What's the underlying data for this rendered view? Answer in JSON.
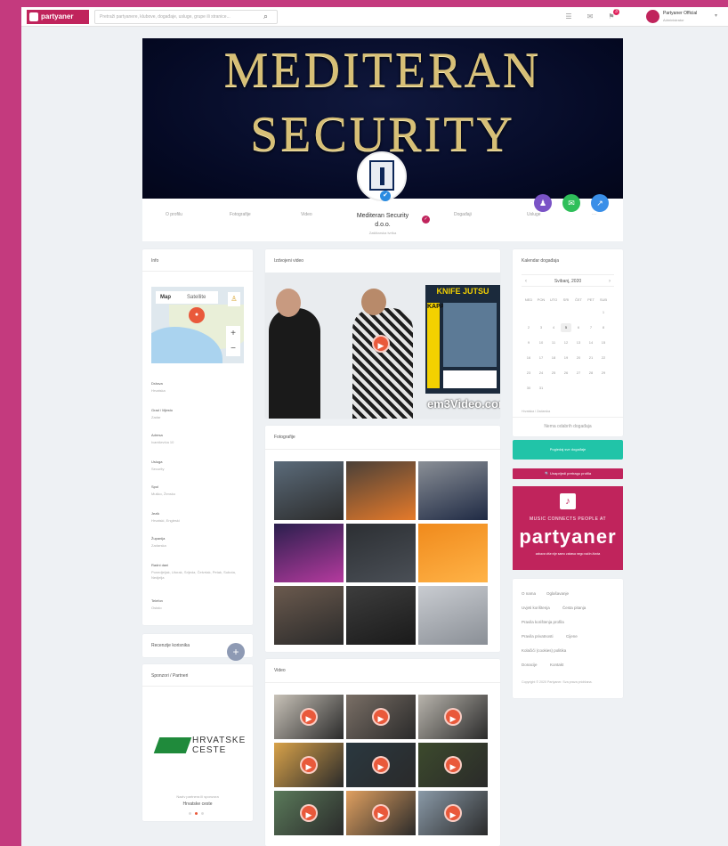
{
  "topbar": {
    "logo_text": "partyaner",
    "search_placeholder": "Pretraži partyanere, klubove, događaje, usluge, grupe ili stranice...",
    "notification_count": "3",
    "user_name": "Partyaner Official",
    "user_sub": "Administrator"
  },
  "cover": {
    "line1": "MEDITERAN",
    "line2": "SECURITY"
  },
  "profile": {
    "name_line1": "Mediteran Security",
    "name_line2": "d.o.o.",
    "subtitle": "Zaštitarska tvrtka",
    "nav": [
      "O profilu",
      "Fotografije",
      "Video",
      "Događaji",
      "Usluge",
      "···"
    ]
  },
  "info": {
    "title": "Info",
    "map_tabs": [
      "Map",
      "Satellite"
    ],
    "fields": [
      {
        "label": "Država",
        "value": "Hrvatska"
      },
      {
        "label": "Grad / Mjesto",
        "value": "Zadar"
      },
      {
        "label": "Adresa",
        "value": "Ivaniševića 10"
      },
      {
        "label": "Usluga",
        "value": "Security"
      },
      {
        "label": "Spol",
        "value": "Muško, Žensko"
      },
      {
        "label": "Jezik",
        "value": "Hrvatski, Engleski"
      },
      {
        "label": "Županija",
        "value": "Zadarska"
      },
      {
        "label": "Radni dani",
        "value": "Ponedjeljak, Utorak, Srijeda, Četvrtak, Petak, Subota, Nedjelja"
      },
      {
        "label": "Telefon",
        "value": "Ostalo"
      }
    ]
  },
  "reviews": {
    "title": "Recenzije korisnika"
  },
  "sponsors": {
    "title": "Sponzori / Partneri",
    "logo_line1": "HRVATSKE",
    "logo_line2": "CESTE",
    "caption": "Naziv partnera ili sponzora",
    "name": "Hrvatske ceste"
  },
  "featured_video": {
    "title": "Izdvojeni video",
    "poster_title": "KNIFE JUTSU",
    "poster_side": "KAPAP",
    "watermark": "em3Video.com"
  },
  "photos": {
    "title": "Fotografije"
  },
  "videos": {
    "title": "Video"
  },
  "calendar": {
    "title": "Kalendar događaja",
    "month": "Svibanj, 2020",
    "weekdays": [
      "NED",
      "PON",
      "UTO",
      "SRI",
      "ČET",
      "PET",
      "SUB"
    ],
    "days": [
      "1",
      "2",
      "3",
      "4",
      "5",
      "6",
      "7",
      "8",
      "9",
      "10",
      "11",
      "12",
      "13",
      "14",
      "15",
      "16",
      "17",
      "18",
      "19",
      "20",
      "21",
      "22",
      "23",
      "24",
      "25",
      "26",
      "27",
      "28",
      "29",
      "30",
      "31"
    ],
    "today": "5",
    "legend": "Hrvatska / Zadarska",
    "no_events": "Nema odabrih događaja"
  },
  "actions": {
    "events_btn": "Pogledaj sve događaje",
    "promote_btn": "Unaprijedi pretragu profila"
  },
  "promo": {
    "line1": "MUSIC CONNECTS PEOPLE AT",
    "brand": "partyaner",
    "line3": "zabava više nije samo zabava nego način života"
  },
  "footer": {
    "links": [
      "O nama",
      "Oglašavanje",
      "Uvjeti korištenja",
      "Česta pitanja",
      "Pravila korištenja profila",
      "Pravila privatnosti",
      "Cijene",
      "Kolačići (cookies) politika",
      "Donacije",
      "Kontakt"
    ],
    "copyright": "Copyright © 2020 Partyaner. Sva prava pridržana."
  }
}
